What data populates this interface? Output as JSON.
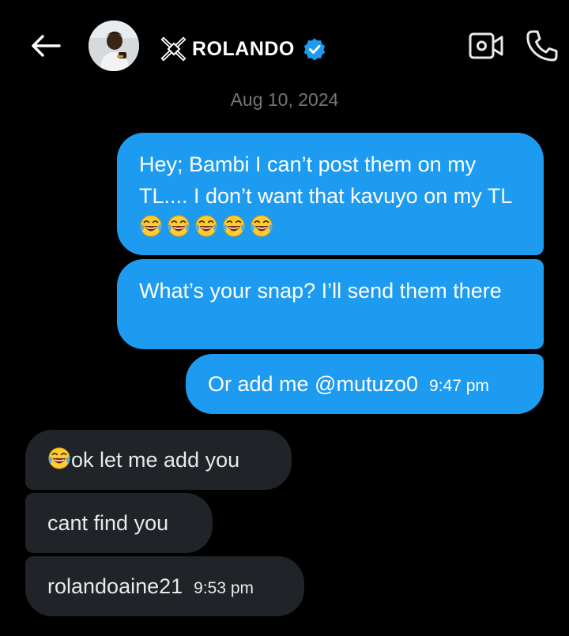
{
  "header": {
    "name": "ROLANDO",
    "icons": {
      "back": "arrow-left-icon",
      "x_mark": "x-logo-icon",
      "verified": "verified-badge-icon",
      "video": "video-camera-icon",
      "call": "phone-icon"
    },
    "colors": {
      "accent": "#1d9bf0",
      "background": "#000000",
      "incoming_bubble": "#202327",
      "muted_text": "#71767b"
    }
  },
  "date_separator": "Aug 10, 2024",
  "messages": {
    "m1": {
      "text_before": "Hey; Bambi I can’t post them on my TL.... I don’t want that kavuyo on my TL",
      "emoji": "face-with-tears-of-joy-icon",
      "emoji_count": 5
    },
    "m2": {
      "text": "What’s your snap? I’ll send them there"
    },
    "m3": {
      "text": "Or add me @mutuzo0",
      "time": "9:47 pm"
    },
    "m4": {
      "emoji": "face-with-tears-of-joy-icon",
      "text": "ok let me add you"
    },
    "m5": {
      "text": "cant find you"
    },
    "m6": {
      "text": "rolandoaine21",
      "time": "9:53 pm"
    }
  }
}
